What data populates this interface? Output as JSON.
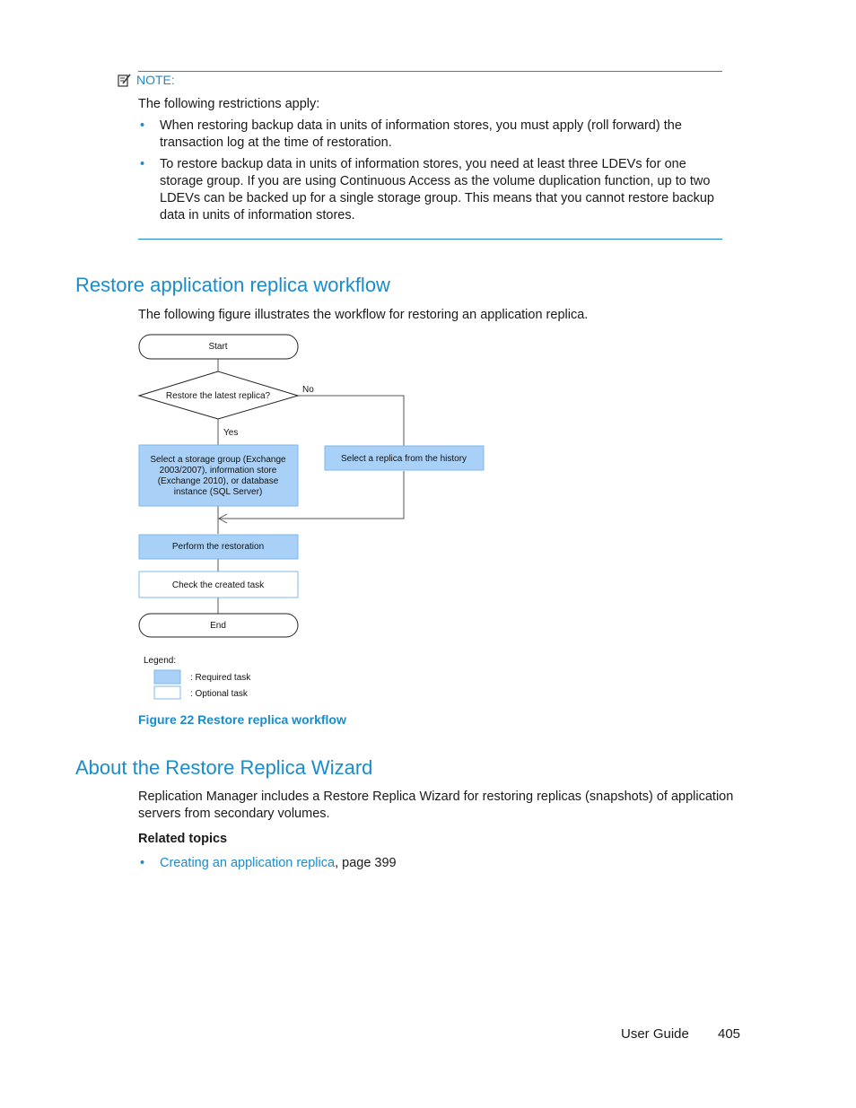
{
  "note": {
    "icon": "note-icon",
    "label": "NOTE:",
    "intro": "The following restrictions apply:",
    "bullets": [
      "When restoring backup data in units of information stores, you must apply (roll forward) the transaction log at the time of restoration.",
      "To restore backup data in units of information stores, you need at least three LDEVs for one storage group. If you are using Continuous Access as the volume duplication function, up to two LDEVs can be backed up for a single storage group. This means that you cannot restore backup data in units of information stores."
    ]
  },
  "section1": {
    "heading": "Restore application replica workflow",
    "intro": "The following figure illustrates the workflow for restoring an application replica."
  },
  "flowchart": {
    "start": "Start",
    "decision": "Restore the latest replica?",
    "no_label": "No",
    "yes_label": "Yes",
    "select_group_lines": [
      "Select a storage group (Exchange",
      "2003/2007), information store",
      "(Exchange 2010), or database",
      "instance (SQL Server)"
    ],
    "select_history": "Select a replica from the history",
    "perform": "Perform the restoration",
    "check": "Check the created task",
    "end": "End",
    "legend_title": "Legend:",
    "legend_required": ": Required task",
    "legend_optional": ": Optional  task",
    "colors": {
      "required_fill": "#a9d1f7",
      "required_stroke": "#7db8ee",
      "optional_stroke": "#7db8ee"
    }
  },
  "figure_caption": "Figure 22 Restore replica workflow",
  "section2": {
    "heading": "About the Restore Replica Wizard",
    "body": "Replication Manager includes a Restore Replica Wizard for restoring replicas (snapshots) of application servers from secondary volumes.",
    "related_title": "Related topics",
    "related": [
      {
        "link": "Creating an application replica",
        "suffix": ", page 399"
      }
    ]
  },
  "footer": {
    "title": "User Guide",
    "page": "405"
  }
}
